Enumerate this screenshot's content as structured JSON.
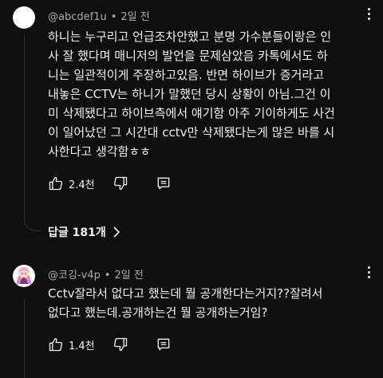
{
  "comments": [
    {
      "author": "@abcdef1u",
      "time": "2일 전",
      "lines": [
        "하니는 누구리고 언급조차안했고 분명 가수분들이랑은 인",
        "사 잘 했다며 매니저의 발언을 문제삼았음 카톡에서도 하",
        "니는 일관적이게 주장하고있음. 반면 하이브가 증거라고",
        "내놓은 CCTV는 하니가 말했던 당시 상황이 아님.그건 이",
        "미 삭제됐다고 하이브측에서 얘기함 아주 기이하게도 사건",
        "이 일어났던 그 시간대 cctv만 삭제됐다는게 많은 바를 시",
        "사한다고 생각함ㅎㅎ"
      ],
      "likes": "2.4천",
      "replies_label": "답글 181개"
    },
    {
      "author": "@코깅-v4p",
      "time": "2일 전",
      "lines": [
        "Cctv잘라서 없다고 했는데 뭘 공개한다는거지??잘려서",
        "없다고 했는데.공개하는건 뭘 공개하는거임?"
      ],
      "likes": "1.4천"
    }
  ],
  "icons": {
    "like": "thumbs-up-icon",
    "dislike": "thumbs-down-icon",
    "reply": "comment-reply-icon",
    "more": "more-vertical-icon",
    "chevron": "chevron-right-icon"
  },
  "colors": {
    "background": "#0f0f0f",
    "text": "#f1f1f1",
    "meta": "#aaaaaa"
  }
}
